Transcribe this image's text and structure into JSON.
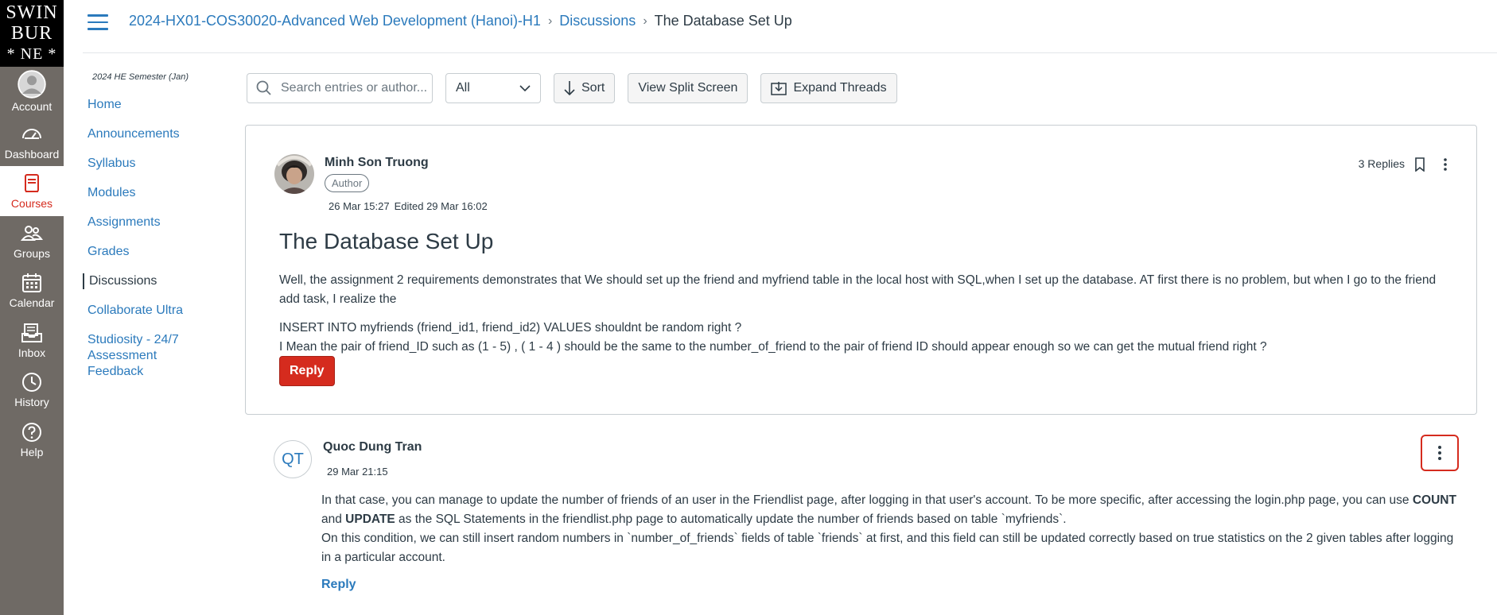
{
  "logo": {
    "line1": "SWIN",
    "line2": "BUR",
    "line3": "* NE *"
  },
  "global_nav": [
    {
      "label": "Account",
      "icon": "account-icon"
    },
    {
      "label": "Dashboard",
      "icon": "dashboard-icon"
    },
    {
      "label": "Courses",
      "icon": "courses-icon",
      "active": true
    },
    {
      "label": "Groups",
      "icon": "groups-icon"
    },
    {
      "label": "Calendar",
      "icon": "calendar-icon"
    },
    {
      "label": "Inbox",
      "icon": "inbox-icon"
    },
    {
      "label": "History",
      "icon": "history-icon"
    },
    {
      "label": "Help",
      "icon": "help-icon"
    }
  ],
  "breadcrumb": {
    "course": "2024-HX01-COS30020-Advanced Web Development (Hanoi)-H1",
    "section": "Discussions",
    "current": "The Database Set Up"
  },
  "course_nav": {
    "term": "2024 HE Semester (Jan)",
    "items": [
      {
        "label": "Home"
      },
      {
        "label": "Announcements"
      },
      {
        "label": "Syllabus"
      },
      {
        "label": "Modules"
      },
      {
        "label": "Assignments"
      },
      {
        "label": "Grades"
      },
      {
        "label": "Discussions",
        "active": true
      },
      {
        "label": "Collaborate Ultra"
      },
      {
        "label": "Studiosity - 24/7 Assessment Feedback"
      }
    ]
  },
  "toolbar": {
    "search_placeholder": "Search entries or author...",
    "filter_value": "All",
    "sort_label": "Sort",
    "split_label": "View Split Screen",
    "expand_label": "Expand Threads"
  },
  "post": {
    "author": "Minh Son Truong",
    "author_role": "Author",
    "posted": "26 Mar 15:27",
    "edited": "Edited 29 Mar 16:02",
    "replies": "3 Replies",
    "title": "The Database Set Up",
    "body_p1": "Well, the assignment 2 requirements demonstrates that We should set up the friend and myfriend table in the local host with SQL,when I set up the database. AT first there is no problem, but when I go to the friend add task, I realize the",
    "body_p2": "INSERT INTO myfriends (friend_id1, friend_id2) VALUES shouldnt be random right ?",
    "body_p3": "I Mean the pair of friend_ID such as (1 - 5) , ( 1 - 4 ) should be the same to the number_of_friend to the pair of friend ID should appear enough so we can get the mutual friend right ?",
    "reply_label": "Reply"
  },
  "reply": {
    "initials": "QT",
    "author": "Quoc Dung Tran",
    "posted": "29 Mar 21:15",
    "body_a": "In that case, you can manage to update the number of friends of an user in the Friendlist page, after logging in that user's account. To be more specific, after accessing the login.php page, you can use ",
    "body_count": "COUNT",
    "body_and": " and ",
    "body_update": "UPDATE",
    "body_b": " as the SQL Statements in the friendlist.php page to automatically update the number of friends based on table `myfriends`.",
    "body_c": "On this condition, we can still insert random numbers in `number_of_friends` fields of table `friends` at first, and this field can still be updated correctly based on true statistics on the 2 given tables after logging in a particular account.",
    "reply_label": "Reply"
  },
  "colors": {
    "brand_red": "#d52b1e",
    "link_blue": "#2b7abc",
    "nav_bg": "#6f6a65"
  }
}
